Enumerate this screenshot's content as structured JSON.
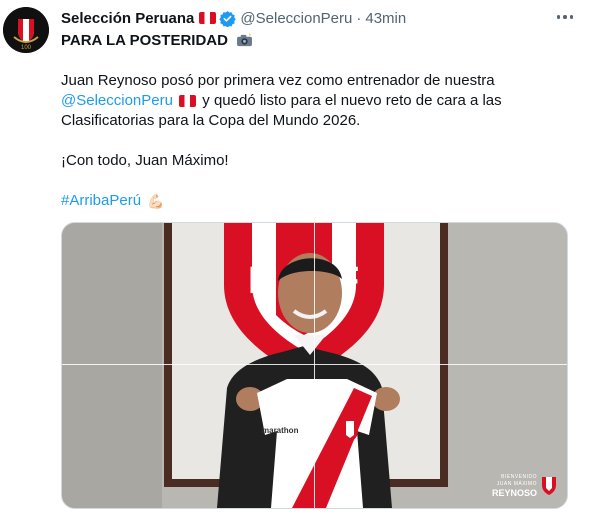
{
  "tweet": {
    "author": {
      "name": "Selección Peruana",
      "handle": "@SeleccionPeru",
      "separator": "·",
      "time": "43min"
    },
    "content": {
      "headline": "PARA LA POSTERIDAD",
      "para1_pre": "Juan Reynoso posó por primera vez como entrenador de nuestra",
      "mention": "@SeleccionPeru",
      "para1_post": "y quedó listo para el nuevo reto de cara a las Clasificatorias para la Copa del Mundo 2026.",
      "para2": "¡Con todo, Juan Máximo!",
      "hashtag": "#ArribaPerú"
    },
    "media": {
      "crest_letters": [
        "F",
        "F"
      ],
      "jersey_sponsor": "marathon",
      "badge_line1": "BIENVENIDO",
      "badge_line2": "JUAN MÁXIMO",
      "badge_line3": "REYNOSO"
    },
    "icons": {
      "verified": "verified-badge-icon",
      "flag": "peru-flag-icon",
      "more": "more-options-icon",
      "camera": "camera-flash-icon",
      "arm": "flexed-biceps-icon"
    },
    "colors": {
      "link": "#1d9bf0",
      "peru_red": "#d91023",
      "text": "#0f1419",
      "muted": "#536471"
    }
  }
}
